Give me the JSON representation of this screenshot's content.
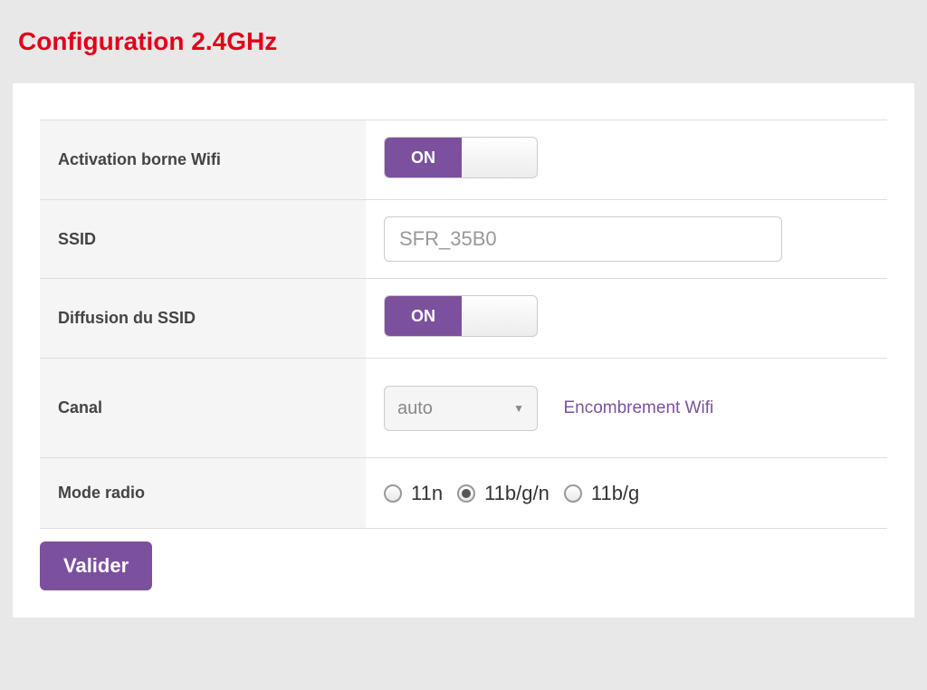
{
  "title": "Configuration 2.4GHz",
  "toggle": {
    "on_label": "ON"
  },
  "fields": {
    "activation": {
      "label": "Activation borne Wifi",
      "state": "ON"
    },
    "ssid": {
      "label": "SSID",
      "value": "SFR_35B0"
    },
    "diffusion": {
      "label": "Diffusion du SSID",
      "state": "ON"
    },
    "canal": {
      "label": "Canal",
      "selected": "auto",
      "link": "Encombrement Wifi"
    },
    "mode_radio": {
      "label": "Mode radio",
      "options": [
        "11n",
        "11b/g/n",
        "11b/g"
      ],
      "selected": "11b/g/n"
    }
  },
  "submit_label": "Valider"
}
